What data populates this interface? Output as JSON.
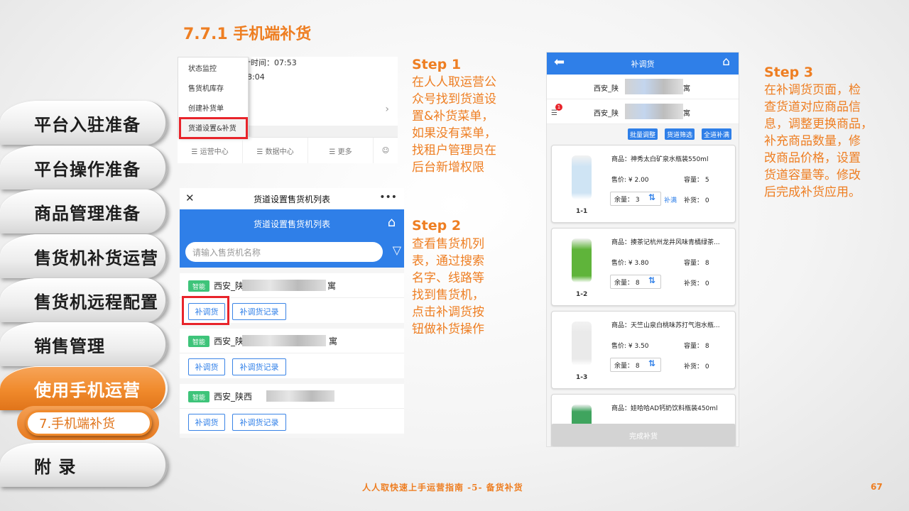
{
  "title": "7.7.1 手机端补货",
  "nav": {
    "items": [
      "平台入驻准备",
      "平台操作准备",
      "商品管理准备",
      "售货机补货运营",
      "售货机远程配置",
      "销售管理",
      "使用手机运营",
      "附 录"
    ],
    "sub_item": "7.手机端补货"
  },
  "shot1": {
    "meta_time1": "计时间：07:53",
    "meta_time2": "8:04",
    "menu": [
      "状态监控",
      "售货机库存",
      "创建补货单",
      "货道设置&补货"
    ],
    "tabs": [
      "☰ 运营中心",
      "☰ 数据中心",
      "☰ 更多",
      "☺"
    ]
  },
  "shot2": {
    "top_title": "货道设置售货机列表",
    "header_title": "货道设置售货机列表",
    "search_placeholder": "请输入售货机名称",
    "cards": [
      {
        "badge": "智能",
        "name": "西安_陕",
        "tail": "寓",
        "btn1": "补调货",
        "btn2": "补调货记录"
      },
      {
        "badge": "智能",
        "name": "西安_陕",
        "tail": "寓",
        "btn1": "补调货",
        "btn2": "补调货记录"
      },
      {
        "badge": "智能",
        "name": "西安_陕西",
        "tail": "",
        "btn1": "补调货",
        "btn2": "补调货记录"
      }
    ]
  },
  "steps": {
    "s1_title": "Step 1",
    "s1_body": [
      "在人人取运营公",
      "众号找到货道设",
      "置&补货菜单，",
      "如果没有菜单，",
      "找租户管理员在",
      "后台新增权限"
    ],
    "s2_title": "Step 2",
    "s2_body": [
      "查看售货机列",
      "表，通过搜索",
      "名字、线路等",
      "找到售货机，",
      "点击补调货按",
      "钮做补货操作"
    ],
    "s3_title": "Step 3",
    "s3_body": [
      "在补调货页面，检",
      "查货道对应商品信",
      "息，调整更换商品，",
      "补充商品数量，修",
      "改商品价格，设置",
      "货道容量等。修改",
      "后完成补货应用。"
    ]
  },
  "shot3": {
    "header_title": "补调货",
    "rows": [
      {
        "name": "西安_陕",
        "tail": "寓"
      },
      {
        "name": "西安_陕",
        "tail": "寓",
        "badge": "1"
      }
    ],
    "actions": [
      "批量调整",
      "货道筛选",
      "全道补满"
    ],
    "products": [
      {
        "code": "1-1",
        "name": "商品：神秀太白矿泉水瓶装550ml",
        "price": "售价: ¥ 2.00",
        "capacity": "容量：  5",
        "remain": "余量：  3",
        "fill": "补满",
        "replenish": "补货：  0",
        "color": "#cfe4f4"
      },
      {
        "code": "1-2",
        "name": "商品：揍茶记杭州龙井风味青橘绿茶...",
        "price": "售价: ¥ 3.80",
        "capacity": "容量：  8",
        "remain": "余量：  8",
        "fill": "",
        "replenish": "补货：  0",
        "color": "#5fb43a"
      },
      {
        "code": "1-3",
        "name": "商品：天竺山泉白桃味苏打气泡水瓶...",
        "price": "售价: ¥ 3.50",
        "capacity": "容量：  8",
        "remain": "余量：  8",
        "fill": "",
        "replenish": "补货：  0",
        "color": "#eaeaea"
      },
      {
        "code": "",
        "name": "商品：娃哈哈AD钙奶饮料瓶装450ml",
        "price": "",
        "capacity": "",
        "remain": "",
        "fill": "",
        "replenish": "",
        "color": "#3fa45e"
      }
    ],
    "bottom_button": "完成补货"
  },
  "footer": {
    "text": "人人取快速上手运营指南 -5- 备货补货",
    "page": "67"
  }
}
